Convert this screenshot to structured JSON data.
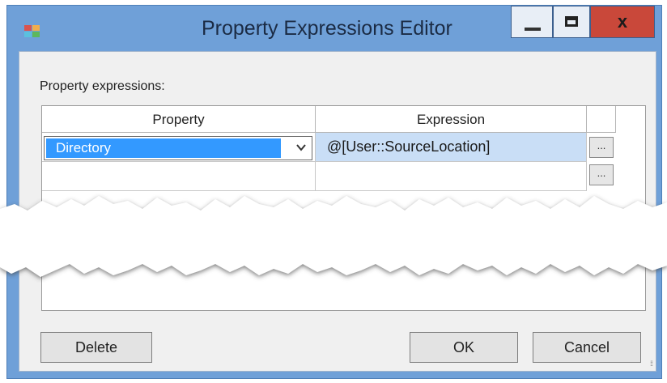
{
  "window": {
    "title": "Property Expressions Editor",
    "close_label": "x"
  },
  "dialog": {
    "section_label": "Property expressions:",
    "grid": {
      "columns": [
        "Property",
        "Expression"
      ],
      "rows": [
        {
          "property": "Directory",
          "expression": "@[User::SourceLocation]",
          "selected": true,
          "ellipsis": "..."
        },
        {
          "property": "",
          "expression": "",
          "selected": false,
          "ellipsis": "..."
        }
      ]
    },
    "buttons": {
      "delete": "Delete",
      "ok": "OK",
      "cancel": "Cancel"
    }
  },
  "colors": {
    "title_bar": "#6fa0d8",
    "selection": "#3399ff",
    "row_highlight": "#c9def6",
    "close_button": "#c9483a"
  },
  "icons": {
    "app": "dialog-app-icon",
    "minimize": "minimize-icon",
    "maximize": "maximize-icon",
    "close": "close-icon",
    "dropdown": "chevron-down-icon",
    "resize": "resize-grip-icon"
  }
}
